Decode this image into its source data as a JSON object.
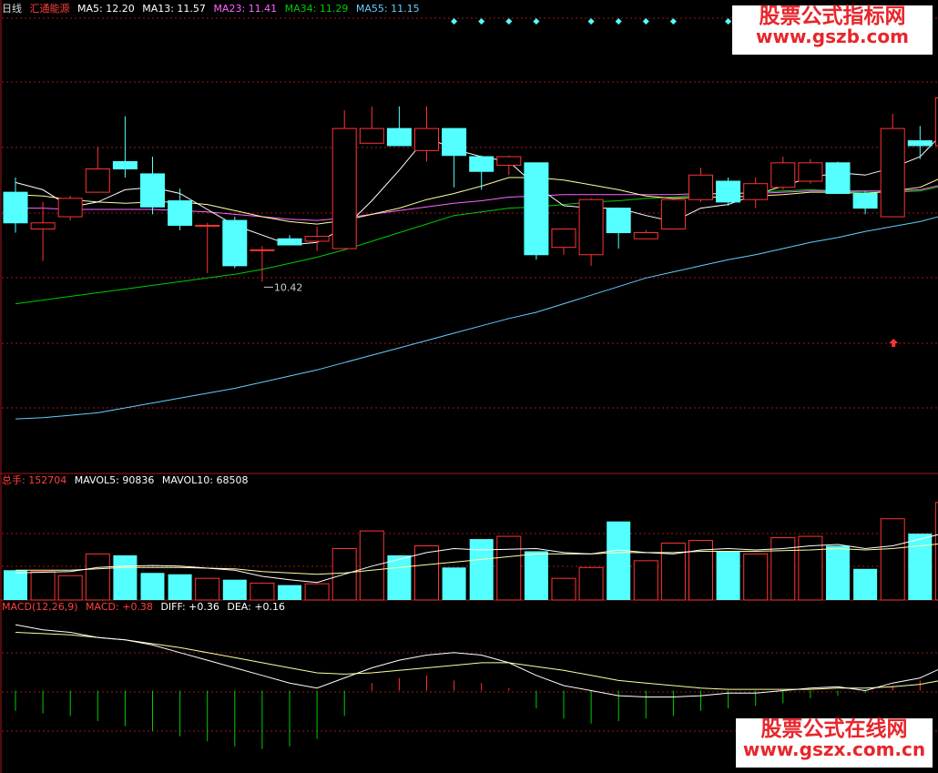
{
  "header": {
    "period": "日线",
    "stock_name": "汇通能源",
    "ma_values": [
      {
        "label": "MA5: 12.20",
        "color": "#ffffff"
      },
      {
        "label": "MA13: 11.57",
        "color": "#ffffff"
      },
      {
        "label": "MA23: 11.41",
        "color": "#ff66ff"
      },
      {
        "label": "MA34: 11.29",
        "color": "#00cc00"
      },
      {
        "label": "MA55: 11.15",
        "color": "#66ccff"
      }
    ]
  },
  "volume_header": {
    "label": "总手: 152704",
    "mavol5": "MAVOL5: 90836",
    "mavol10": "MAVOL10: 68508"
  },
  "macd_header": {
    "label": "MACD(12,26,9)",
    "macd": "MACD: +0.38",
    "diff": "DIFF: +0.36",
    "dea": "DEA: +0.16"
  },
  "annotations": {
    "low_price": "10.42"
  },
  "watermarks": {
    "top_line1": "股票公式指标网",
    "top_line2": "www.gszb.com",
    "bottom_line1": "股票公式在线网",
    "bottom_line2": "www.gszx.com.cn"
  },
  "colors": {
    "up": "#ff3333",
    "down": "#54ffff",
    "grid": "#a01818",
    "macd_pos": "#ff3333",
    "macd_neg": "#00cc00"
  },
  "chart_data": {
    "type": "candlestick",
    "price_ylim": [
      9.4,
      13.1
    ],
    "candles": [
      {
        "o": 11.68,
        "c": 11.43,
        "h": 11.8,
        "l": 11.35
      },
      {
        "o": 11.38,
        "c": 11.43,
        "h": 11.6,
        "l": 11.12
      },
      {
        "o": 11.48,
        "c": 11.63,
        "h": 11.65,
        "l": 11.45
      },
      {
        "o": 11.68,
        "c": 11.87,
        "h": 12.05,
        "l": 11.68
      },
      {
        "o": 11.93,
        "c": 11.87,
        "h": 12.3,
        "l": 11.8
      },
      {
        "o": 11.83,
        "c": 11.56,
        "h": 11.97,
        "l": 11.5
      },
      {
        "o": 11.61,
        "c": 11.41,
        "h": 11.71,
        "l": 11.37
      },
      {
        "o": 11.41,
        "c": 11.41,
        "h": 11.43,
        "l": 11.02
      },
      {
        "o": 11.45,
        "c": 11.08,
        "h": 11.48,
        "l": 11.06
      },
      {
        "o": 11.21,
        "c": 11.21,
        "h": 11.24,
        "l": 10.95
      },
      {
        "o": 11.3,
        "c": 11.25,
        "h": 11.33,
        "l": 11.25
      },
      {
        "o": 11.28,
        "c": 11.32,
        "h": 11.4,
        "l": 11.2
      },
      {
        "o": 11.22,
        "c": 12.2,
        "h": 12.35,
        "l": 11.22
      },
      {
        "o": 12.08,
        "c": 12.2,
        "h": 12.38,
        "l": 12.08
      },
      {
        "o": 12.2,
        "c": 12.06,
        "h": 12.38,
        "l": 12.06
      },
      {
        "o": 12.02,
        "c": 12.2,
        "h": 12.38,
        "l": 11.93
      },
      {
        "o": 12.2,
        "c": 11.98,
        "h": 12.2,
        "l": 11.72
      },
      {
        "o": 11.97,
        "c": 11.85,
        "h": 11.98,
        "l": 11.7
      },
      {
        "o": 11.9,
        "c": 11.97,
        "h": 11.98,
        "l": 11.82
      },
      {
        "o": 11.92,
        "c": 11.17,
        "h": 11.92,
        "l": 11.13
      },
      {
        "o": 11.23,
        "c": 11.38,
        "h": 11.38,
        "l": 11.17
      },
      {
        "o": 11.17,
        "c": 11.62,
        "h": 11.63,
        "l": 11.08
      },
      {
        "o": 11.55,
        "c": 11.35,
        "h": 11.55,
        "l": 11.22
      },
      {
        "o": 11.3,
        "c": 11.35,
        "h": 11.37,
        "l": 11.3
      },
      {
        "o": 11.38,
        "c": 11.62,
        "h": 11.62,
        "l": 11.38
      },
      {
        "o": 11.62,
        "c": 11.82,
        "h": 11.88,
        "l": 11.6
      },
      {
        "o": 11.77,
        "c": 11.6,
        "h": 11.8,
        "l": 11.57
      },
      {
        "o": 11.62,
        "c": 11.75,
        "h": 11.8,
        "l": 11.55
      },
      {
        "o": 11.72,
        "c": 11.92,
        "h": 11.97,
        "l": 11.7
      },
      {
        "o": 11.77,
        "c": 11.92,
        "h": 11.95,
        "l": 11.75
      },
      {
        "o": 11.92,
        "c": 11.67,
        "h": 11.93,
        "l": 11.67
      },
      {
        "o": 11.67,
        "c": 11.55,
        "h": 11.69,
        "l": 11.5
      },
      {
        "o": 11.48,
        "c": 12.2,
        "h": 12.32,
        "l": 11.48
      },
      {
        "o": 12.1,
        "c": 12.06,
        "h": 12.22,
        "l": 11.95
      },
      {
        "o": 12.06,
        "c": 12.45,
        "h": 12.52,
        "l": 12.05
      }
    ],
    "ma5": [
      11.76,
      11.7,
      11.56,
      11.6,
      11.7,
      11.72,
      11.67,
      11.54,
      11.41,
      11.33,
      11.25,
      11.27,
      11.39,
      11.61,
      11.86,
      12.13,
      12.03,
      11.97,
      11.93,
      11.73,
      11.57,
      11.55,
      11.55,
      11.49,
      11.44,
      11.55,
      11.58,
      11.66,
      11.73,
      11.8,
      11.84,
      11.82,
      11.88,
      11.97,
      12.2
    ],
    "ma13": [
      11.66,
      11.65,
      11.62,
      11.6,
      11.59,
      11.6,
      11.6,
      11.58,
      11.53,
      11.48,
      11.44,
      11.42,
      11.45,
      11.5,
      11.55,
      11.62,
      11.67,
      11.73,
      11.8,
      11.8,
      11.78,
      11.74,
      11.7,
      11.65,
      11.63,
      11.64,
      11.64,
      11.65,
      11.66,
      11.68,
      11.68,
      11.67,
      11.69,
      11.72,
      11.82
    ],
    "ma23": [
      11.55,
      11.55,
      11.54,
      11.54,
      11.54,
      11.54,
      11.53,
      11.52,
      11.5,
      11.48,
      11.46,
      11.45,
      11.47,
      11.5,
      11.53,
      11.56,
      11.59,
      11.61,
      11.64,
      11.65,
      11.66,
      11.66,
      11.66,
      11.66,
      11.66,
      11.67,
      11.67,
      11.67,
      11.68,
      11.69,
      11.69,
      11.69,
      11.69,
      11.7,
      11.75
    ],
    "ma34": [
      10.77,
      10.8,
      10.83,
      10.86,
      10.89,
      10.92,
      10.95,
      10.98,
      11.01,
      11.05,
      11.1,
      11.15,
      11.21,
      11.28,
      11.35,
      11.42,
      11.49,
      11.52,
      11.55,
      11.56,
      11.58,
      11.6,
      11.61,
      11.63,
      11.64,
      11.66,
      11.67,
      11.68,
      11.69,
      11.7,
      11.69,
      11.68,
      11.68,
      11.69,
      11.74
    ],
    "ma55": [
      9.83,
      9.84,
      9.86,
      9.88,
      9.92,
      9.96,
      10.0,
      10.04,
      10.08,
      10.13,
      10.18,
      10.23,
      10.29,
      10.35,
      10.41,
      10.47,
      10.53,
      10.59,
      10.65,
      10.7,
      10.77,
      10.84,
      10.91,
      10.98,
      11.03,
      11.08,
      11.13,
      11.17,
      11.22,
      11.27,
      11.31,
      11.36,
      11.4,
      11.44,
      11.5
    ],
    "volume": [
      22000,
      21000,
      18000,
      34000,
      33000,
      20000,
      19000,
      16000,
      15000,
      12500,
      11000,
      12000,
      38000,
      51000,
      33000,
      40000,
      24000,
      45000,
      47000,
      36000,
      16000,
      24000,
      58000,
      29000,
      42000,
      44000,
      36000,
      34000,
      46000,
      47000,
      40000,
      23000,
      60000,
      49000,
      72000
    ],
    "mavol5": [
      20000,
      20500,
      21000,
      24000,
      25000,
      25500,
      25000,
      23500,
      22000,
      17500,
      15000,
      13000,
      19000,
      25000,
      30000,
      35000,
      38000,
      37000,
      37500,
      38000,
      35000,
      34000,
      37000,
      35000,
      34000,
      37000,
      38000,
      37000,
      38000,
      40000,
      41000,
      38000,
      40000,
      45000,
      50000
    ],
    "mavol10": [
      22000,
      22000,
      22000,
      23000,
      24000,
      24000,
      24000,
      23500,
      23000,
      21000,
      20000,
      19000,
      20000,
      22000,
      24000,
      26000,
      28000,
      30000,
      32000,
      34000,
      34000,
      34000,
      35000,
      35000,
      35000,
      36000,
      36000,
      36000,
      36500,
      37000,
      38000,
      37000,
      38000,
      40000,
      42000
    ],
    "volume_ylim": [
      0,
      80000
    ],
    "diff": [
      0.52,
      0.48,
      0.46,
      0.42,
      0.4,
      0.36,
      0.3,
      0.24,
      0.18,
      0.12,
      0.06,
      0.02,
      0.1,
      0.18,
      0.24,
      0.28,
      0.3,
      0.28,
      0.22,
      0.12,
      0.04,
      0.0,
      -0.04,
      -0.05,
      -0.05,
      -0.04,
      -0.02,
      -0.02,
      0.0,
      0.02,
      0.03,
      0.0,
      0.06,
      0.1,
      0.2
    ],
    "dea": [
      0.46,
      0.45,
      0.44,
      0.42,
      0.4,
      0.37,
      0.34,
      0.3,
      0.26,
      0.22,
      0.18,
      0.14,
      0.13,
      0.14,
      0.16,
      0.18,
      0.2,
      0.22,
      0.22,
      0.19,
      0.16,
      0.12,
      0.08,
      0.06,
      0.04,
      0.02,
      0.01,
      0.01,
      0.01,
      0.01,
      0.02,
      0.02,
      0.03,
      0.05,
      0.09
    ],
    "macd": [
      -0.16,
      -0.18,
      -0.2,
      -0.24,
      -0.28,
      -0.32,
      -0.36,
      -0.4,
      -0.44,
      -0.46,
      -0.44,
      -0.38,
      -0.2,
      0.06,
      0.1,
      0.12,
      0.08,
      0.06,
      0.02,
      -0.14,
      -0.22,
      -0.26,
      -0.24,
      -0.22,
      -0.2,
      -0.16,
      -0.14,
      -0.12,
      -0.1,
      -0.06,
      -0.04,
      -0.02,
      0.04,
      0.08,
      0.18
    ],
    "macd_ylim": [
      -0.65,
      0.6
    ]
  }
}
